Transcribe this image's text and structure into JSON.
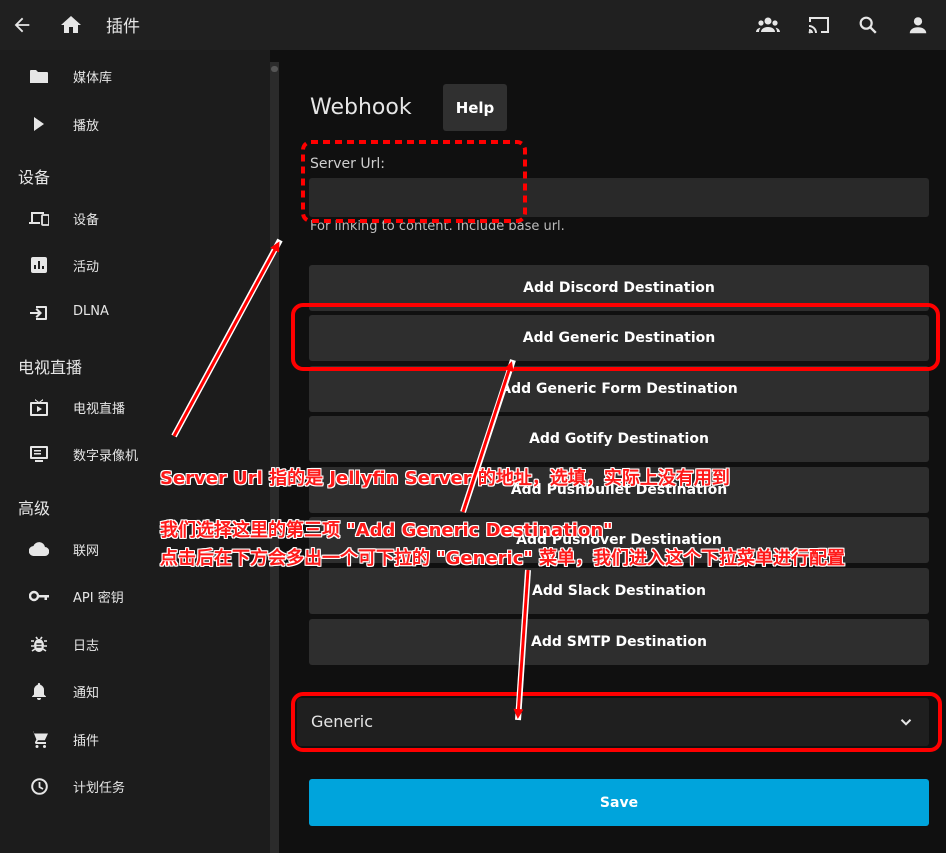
{
  "topbar": {
    "title": "插件",
    "icons": [
      "back-arrow-icon",
      "home-icon",
      "users-icon",
      "cast-icon",
      "search-icon",
      "user-icon"
    ]
  },
  "sidebar": {
    "items_top": [
      {
        "label": "媒体库",
        "icon": "folder-icon"
      },
      {
        "label": "播放",
        "icon": "play-icon"
      }
    ],
    "section_devices": "设备",
    "items_devices": [
      {
        "label": "设备",
        "icon": "devices-icon"
      },
      {
        "label": "活动",
        "icon": "activity-icon"
      },
      {
        "label": "DLNA",
        "icon": "input-icon"
      }
    ],
    "section_livetv": "电视直播",
    "items_livetv": [
      {
        "label": "电视直播",
        "icon": "live-tv-icon"
      },
      {
        "label": "数字录像机",
        "icon": "dvr-icon"
      }
    ],
    "section_advanced": "高级",
    "items_advanced": [
      {
        "label": "联网",
        "icon": "cloud-icon"
      },
      {
        "label": "API 密钥",
        "icon": "key-icon"
      },
      {
        "label": "日志",
        "icon": "bug-icon"
      },
      {
        "label": "通知",
        "icon": "bell-icon"
      },
      {
        "label": "插件",
        "icon": "cart-icon"
      },
      {
        "label": "计划任务",
        "icon": "clock-icon"
      }
    ]
  },
  "main": {
    "title": "Webhook",
    "help_label": "Help",
    "server_url_label": "Server Url:",
    "server_url_value": "",
    "server_url_desc": "For linking to content. Include base url.",
    "destinations": [
      "Add Discord Destination",
      "Add Generic Destination",
      "Add Generic Form Destination",
      "Add Gotify Destination",
      "Add Pushbullet Destination",
      "Add Pushover Destination",
      "Add Slack Destination",
      "Add SMTP Destination"
    ],
    "generic_select_value": "Generic",
    "save_label": "Save"
  },
  "annotations": {
    "line1": "Server Url 指的是 Jellyfin Server 的地址，选填，实际上没有用到",
    "line2": "我们选择这里的第三项 \"Add Generic Destination\"",
    "line3": "点击后在下方会多出一个可下拉的 \"Generic\" 菜单，我们进入这个下拉菜单进行配置",
    "color": "#ff0000"
  }
}
